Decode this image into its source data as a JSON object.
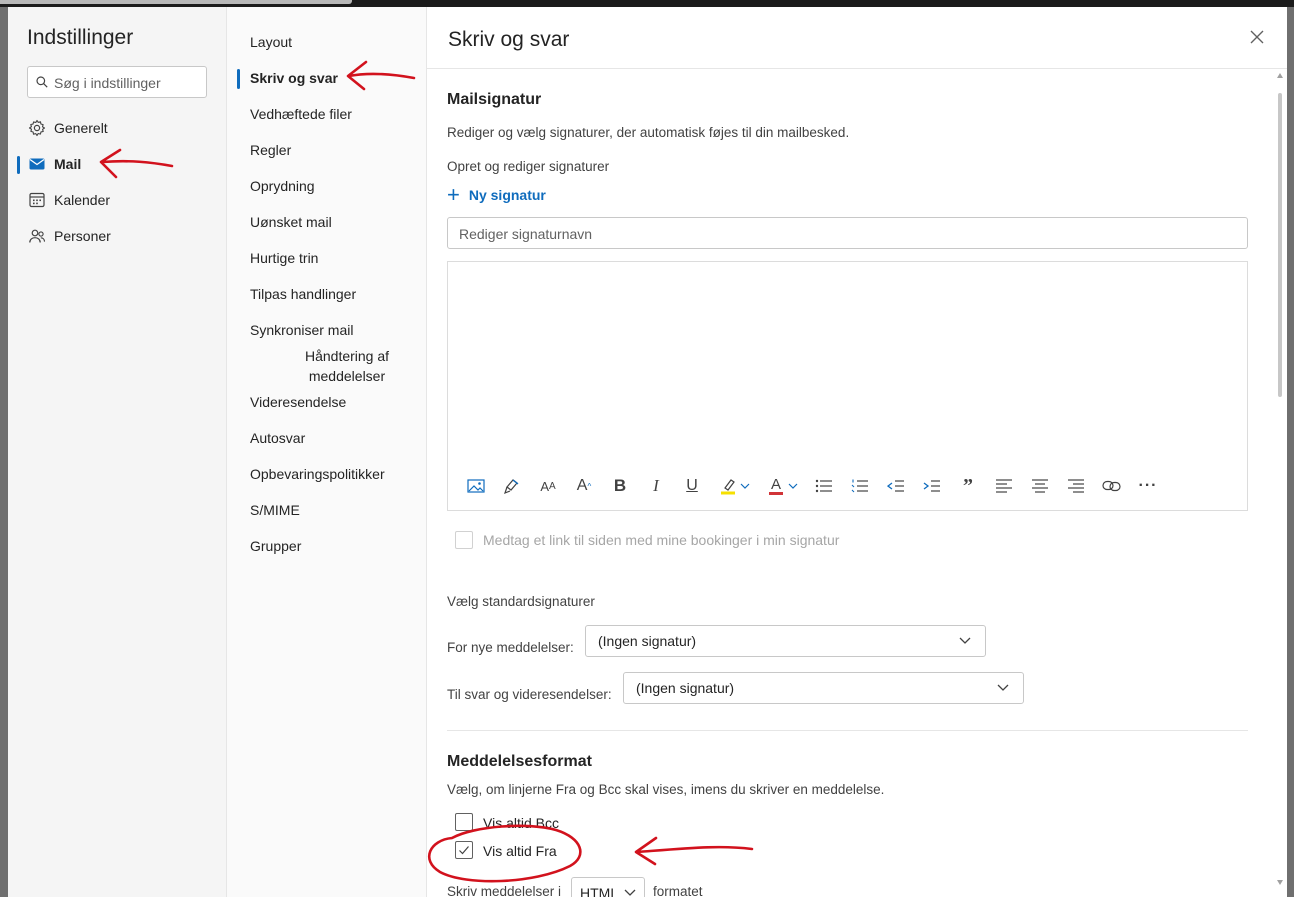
{
  "settings": {
    "title": "Indstillinger",
    "search_placeholder": "Søg i indstillinger",
    "categories": [
      {
        "label": "Generelt",
        "icon": "gear-icon"
      },
      {
        "label": "Mail",
        "icon": "mail-icon",
        "active": true
      },
      {
        "label": "Kalender",
        "icon": "calendar-icon"
      },
      {
        "label": "Personer",
        "icon": "people-icon"
      }
    ]
  },
  "submenu": {
    "items": [
      "Layout",
      "Skriv og svar",
      "Vedhæftede filer",
      "Regler",
      "Oprydning",
      "Uønsket mail",
      "Hurtige trin",
      "Tilpas handlinger",
      "Synkroniser mail",
      "Håndtering af meddelelser",
      "Videresendelse",
      "Autosvar",
      "Opbevaringspolitikker",
      "S/MIME",
      "Grupper"
    ],
    "active": "Skriv og svar"
  },
  "page": {
    "title": "Skriv og svar",
    "signature": {
      "heading": "Mailsignatur",
      "description": "Rediger og vælg signaturer, der automatisk føjes til din mailbesked.",
      "create_label": "Opret og rediger signaturer",
      "new_button": "Ny signatur",
      "name_placeholder": "Rediger signaturnavn",
      "bookings_checkbox": "Medtag et link til siden med mine bookinger i min signatur",
      "defaults_label": "Vælg standardsignaturer",
      "new_messages_label": "For nye meddelelser:",
      "new_messages_value": "(Ingen signatur)",
      "replies_label": "Til svar og videresendelser:",
      "replies_value": "(Ingen signatur)"
    },
    "format": {
      "heading": "Meddelelsesformat",
      "description": "Vælg, om linjerne Fra og Bcc skal vises, imens du skriver en meddelelse.",
      "bcc_label": "Vis altid Bcc",
      "bcc_checked": false,
      "from_label": "Vis altid Fra",
      "from_checked": true,
      "compose_prefix": "Skriv meddelelser i",
      "compose_value": "HTML",
      "compose_suffix": "formatet"
    }
  },
  "toolbar_icons": [
    "insert-picture-icon",
    "format-painter-icon",
    "font-size-icon",
    "grow-font-icon",
    "bold-icon",
    "italic-icon",
    "underline-icon",
    "highlight-icon",
    "font-color-icon",
    "bullets-icon",
    "numbering-icon",
    "decrease-indent-icon",
    "increase-indent-icon",
    "quote-icon",
    "align-left-icon",
    "align-center-icon",
    "align-right-icon",
    "link-icon",
    "more-options-icon"
  ],
  "colors": {
    "accent": "#0f6cbd",
    "annotation": "#d2121d",
    "highlight": "#f6e000",
    "font_color": "#d13438"
  }
}
